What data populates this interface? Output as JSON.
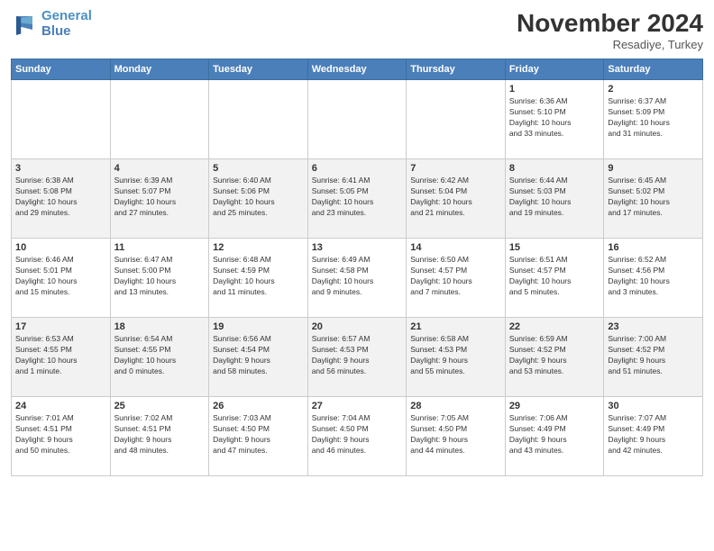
{
  "header": {
    "logo_line1": "General",
    "logo_line2": "Blue",
    "month": "November 2024",
    "location": "Resadiye, Turkey"
  },
  "days_of_week": [
    "Sunday",
    "Monday",
    "Tuesday",
    "Wednesday",
    "Thursday",
    "Friday",
    "Saturday"
  ],
  "weeks": [
    [
      {
        "day": "",
        "info": ""
      },
      {
        "day": "",
        "info": ""
      },
      {
        "day": "",
        "info": ""
      },
      {
        "day": "",
        "info": ""
      },
      {
        "day": "",
        "info": ""
      },
      {
        "day": "1",
        "info": "Sunrise: 6:36 AM\nSunset: 5:10 PM\nDaylight: 10 hours\nand 33 minutes."
      },
      {
        "day": "2",
        "info": "Sunrise: 6:37 AM\nSunset: 5:09 PM\nDaylight: 10 hours\nand 31 minutes."
      }
    ],
    [
      {
        "day": "3",
        "info": "Sunrise: 6:38 AM\nSunset: 5:08 PM\nDaylight: 10 hours\nand 29 minutes."
      },
      {
        "day": "4",
        "info": "Sunrise: 6:39 AM\nSunset: 5:07 PM\nDaylight: 10 hours\nand 27 minutes."
      },
      {
        "day": "5",
        "info": "Sunrise: 6:40 AM\nSunset: 5:06 PM\nDaylight: 10 hours\nand 25 minutes."
      },
      {
        "day": "6",
        "info": "Sunrise: 6:41 AM\nSunset: 5:05 PM\nDaylight: 10 hours\nand 23 minutes."
      },
      {
        "day": "7",
        "info": "Sunrise: 6:42 AM\nSunset: 5:04 PM\nDaylight: 10 hours\nand 21 minutes."
      },
      {
        "day": "8",
        "info": "Sunrise: 6:44 AM\nSunset: 5:03 PM\nDaylight: 10 hours\nand 19 minutes."
      },
      {
        "day": "9",
        "info": "Sunrise: 6:45 AM\nSunset: 5:02 PM\nDaylight: 10 hours\nand 17 minutes."
      }
    ],
    [
      {
        "day": "10",
        "info": "Sunrise: 6:46 AM\nSunset: 5:01 PM\nDaylight: 10 hours\nand 15 minutes."
      },
      {
        "day": "11",
        "info": "Sunrise: 6:47 AM\nSunset: 5:00 PM\nDaylight: 10 hours\nand 13 minutes."
      },
      {
        "day": "12",
        "info": "Sunrise: 6:48 AM\nSunset: 4:59 PM\nDaylight: 10 hours\nand 11 minutes."
      },
      {
        "day": "13",
        "info": "Sunrise: 6:49 AM\nSunset: 4:58 PM\nDaylight: 10 hours\nand 9 minutes."
      },
      {
        "day": "14",
        "info": "Sunrise: 6:50 AM\nSunset: 4:57 PM\nDaylight: 10 hours\nand 7 minutes."
      },
      {
        "day": "15",
        "info": "Sunrise: 6:51 AM\nSunset: 4:57 PM\nDaylight: 10 hours\nand 5 minutes."
      },
      {
        "day": "16",
        "info": "Sunrise: 6:52 AM\nSunset: 4:56 PM\nDaylight: 10 hours\nand 3 minutes."
      }
    ],
    [
      {
        "day": "17",
        "info": "Sunrise: 6:53 AM\nSunset: 4:55 PM\nDaylight: 10 hours\nand 1 minute."
      },
      {
        "day": "18",
        "info": "Sunrise: 6:54 AM\nSunset: 4:55 PM\nDaylight: 10 hours\nand 0 minutes."
      },
      {
        "day": "19",
        "info": "Sunrise: 6:56 AM\nSunset: 4:54 PM\nDaylight: 9 hours\nand 58 minutes."
      },
      {
        "day": "20",
        "info": "Sunrise: 6:57 AM\nSunset: 4:53 PM\nDaylight: 9 hours\nand 56 minutes."
      },
      {
        "day": "21",
        "info": "Sunrise: 6:58 AM\nSunset: 4:53 PM\nDaylight: 9 hours\nand 55 minutes."
      },
      {
        "day": "22",
        "info": "Sunrise: 6:59 AM\nSunset: 4:52 PM\nDaylight: 9 hours\nand 53 minutes."
      },
      {
        "day": "23",
        "info": "Sunrise: 7:00 AM\nSunset: 4:52 PM\nDaylight: 9 hours\nand 51 minutes."
      }
    ],
    [
      {
        "day": "24",
        "info": "Sunrise: 7:01 AM\nSunset: 4:51 PM\nDaylight: 9 hours\nand 50 minutes."
      },
      {
        "day": "25",
        "info": "Sunrise: 7:02 AM\nSunset: 4:51 PM\nDaylight: 9 hours\nand 48 minutes."
      },
      {
        "day": "26",
        "info": "Sunrise: 7:03 AM\nSunset: 4:50 PM\nDaylight: 9 hours\nand 47 minutes."
      },
      {
        "day": "27",
        "info": "Sunrise: 7:04 AM\nSunset: 4:50 PM\nDaylight: 9 hours\nand 46 minutes."
      },
      {
        "day": "28",
        "info": "Sunrise: 7:05 AM\nSunset: 4:50 PM\nDaylight: 9 hours\nand 44 minutes."
      },
      {
        "day": "29",
        "info": "Sunrise: 7:06 AM\nSunset: 4:49 PM\nDaylight: 9 hours\nand 43 minutes."
      },
      {
        "day": "30",
        "info": "Sunrise: 7:07 AM\nSunset: 4:49 PM\nDaylight: 9 hours\nand 42 minutes."
      }
    ]
  ]
}
